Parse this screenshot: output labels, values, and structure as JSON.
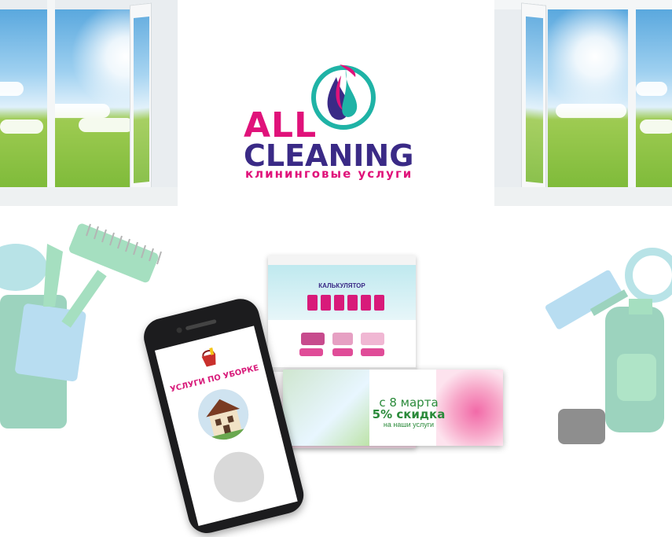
{
  "logo": {
    "word1": "ALL",
    "word2": "CLEANING",
    "tagline": "клининговые   услуги",
    "colors": {
      "pink": "#e0127a",
      "purple": "#3a2a86",
      "teal": "#1fb3a6"
    }
  },
  "phone": {
    "title": "УСЛУГИ ПО УБОРКЕ"
  },
  "banner": {
    "date": "с 8 марта",
    "discount": "5% скидка",
    "subtitle": "на наши услуги",
    "accent": "#2a8a3a"
  },
  "site": {
    "heading": "КАЛЬКУЛЯТОР"
  }
}
